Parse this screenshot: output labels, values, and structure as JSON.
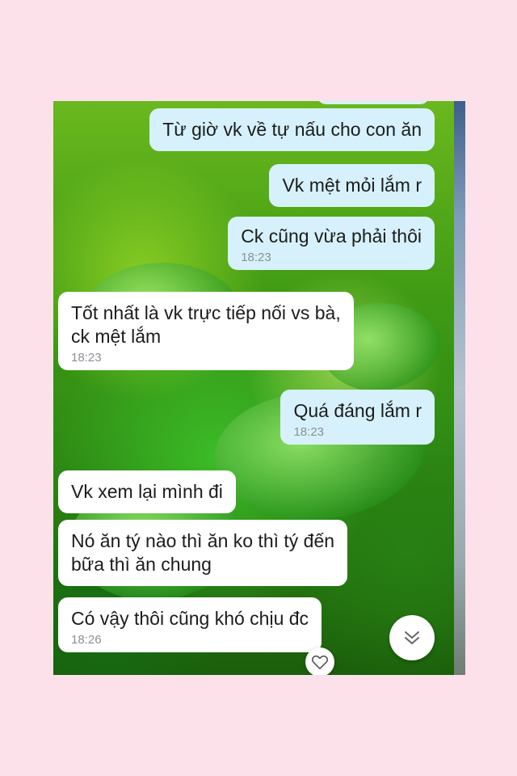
{
  "messages": [
    {
      "side": "out",
      "text": "Từ giờ vk về tự nấu cho con ăn",
      "time": ""
    },
    {
      "side": "out",
      "text": "Vk mệt mỏi lắm r",
      "time": ""
    },
    {
      "side": "out",
      "text": "Ck cũng vừa phải thôi",
      "time": "18:23"
    },
    {
      "side": "in",
      "text": "Tốt nhất là vk trực tiếp nối vs bà,\nck mệt lắm",
      "time": "18:23"
    },
    {
      "side": "out",
      "text": "Quá đáng lắm r",
      "time": "18:23"
    },
    {
      "side": "in",
      "text": "Vk xem lại mình đi",
      "time": ""
    },
    {
      "side": "in",
      "text": "Nó ăn tý nào thì ăn ko thì tý đến\nbữa thì ăn chung",
      "time": ""
    },
    {
      "side": "in",
      "text": "Có vậy thôi cũng khó chịu đc",
      "time": "18:26"
    }
  ],
  "icons": {
    "scroll_down": "double-chevron-down-icon",
    "reaction": "heart-outline-icon"
  },
  "colors": {
    "page_background": "#fce1ea",
    "outgoing_bubble": "#d6f1fb",
    "incoming_bubble": "#ffffff",
    "timestamp": "#8a8f95"
  }
}
